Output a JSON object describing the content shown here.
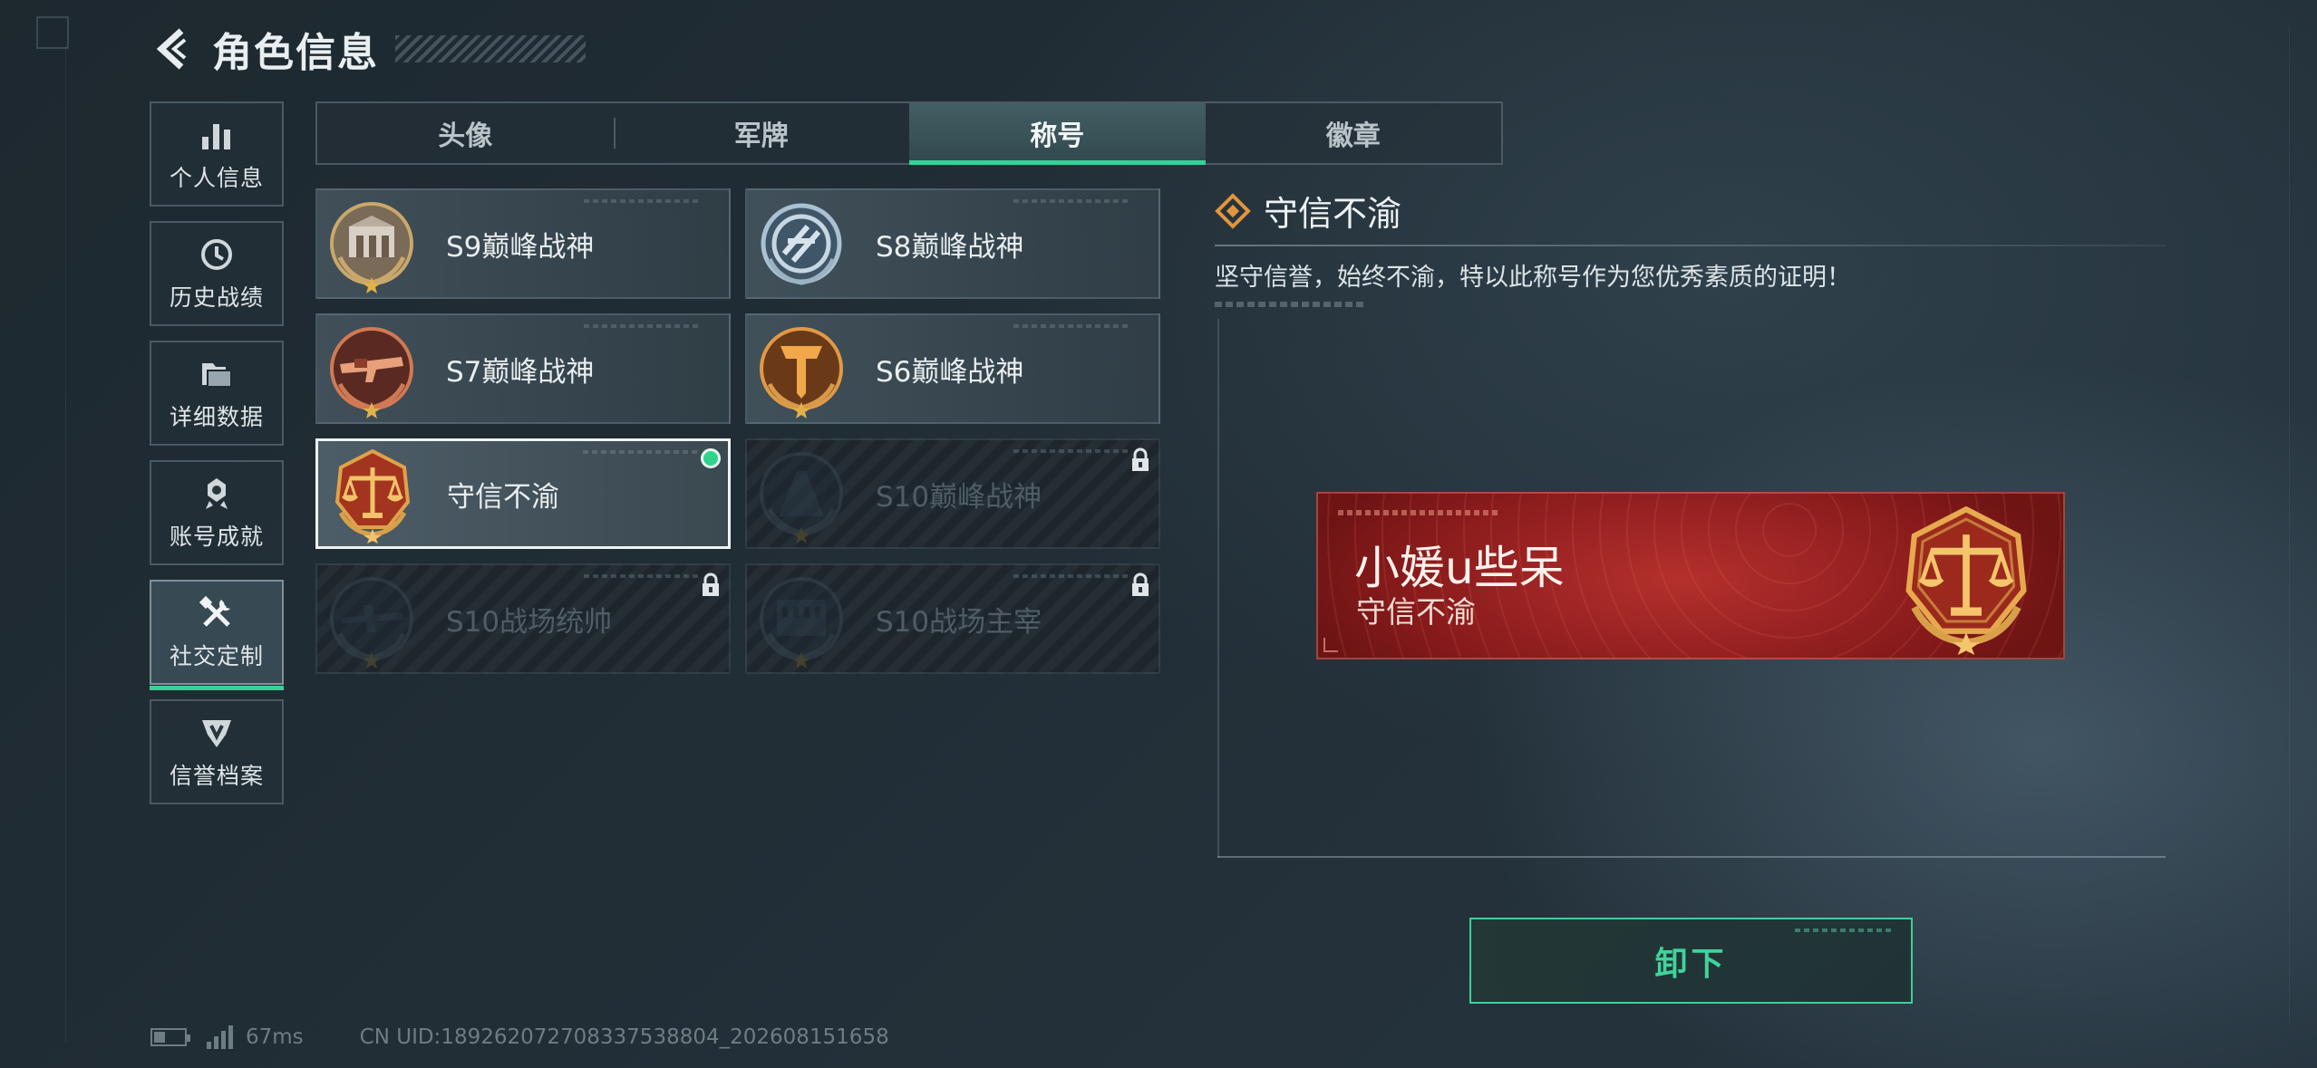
{
  "header": {
    "title": "角色信息"
  },
  "nav": {
    "items": [
      {
        "label": "个人信息",
        "icon": "bar-chart-icon"
      },
      {
        "label": "历史战绩",
        "icon": "history-clock-icon"
      },
      {
        "label": "详细数据",
        "icon": "folder-icon"
      },
      {
        "label": "账号成就",
        "icon": "achievement-icon"
      },
      {
        "label": "社交定制",
        "icon": "tools-icon",
        "active": true
      },
      {
        "label": "信誉档案",
        "icon": "reputation-icon"
      }
    ]
  },
  "tabs": [
    {
      "label": "头像"
    },
    {
      "label": "军牌"
    },
    {
      "label": "称号",
      "active": true
    },
    {
      "label": "徽章"
    }
  ],
  "titles": [
    {
      "name": "S9巅峰战神",
      "icon": "s9-emblem-icon",
      "state": "unlocked"
    },
    {
      "name": "S8巅峰战神",
      "icon": "s8-emblem-icon",
      "state": "unlocked"
    },
    {
      "name": "S7巅峰战神",
      "icon": "s7-emblem-icon",
      "state": "unlocked"
    },
    {
      "name": "S6巅峰战神",
      "icon": "s6-emblem-icon",
      "state": "unlocked"
    },
    {
      "name": "守信不渝",
      "icon": "scales-emblem-icon",
      "state": "equipped"
    },
    {
      "name": "S10巅峰战神",
      "icon": "s10-emblem-icon",
      "state": "locked"
    },
    {
      "name": "S10战场统帅",
      "icon": "aircraft-emblem-icon",
      "state": "locked"
    },
    {
      "name": "S10战场主宰",
      "icon": "colosseum-emblem-icon",
      "state": "locked"
    }
  ],
  "detail": {
    "title": "守信不渝",
    "description": "坚守信誉，始终不渝，特以此称号作为您优秀素质的证明！"
  },
  "nameplate": {
    "player_name": "小媛u些呆",
    "title": "守信不渝"
  },
  "actions": {
    "unequip_label": "卸下"
  },
  "status": {
    "latency": "67ms",
    "uid": "CN UID:18926207270833753880​4_202608151658"
  },
  "colors": {
    "accent": "#36d19a",
    "nameplate_red": "#a52626",
    "text": "#e6ebee"
  }
}
